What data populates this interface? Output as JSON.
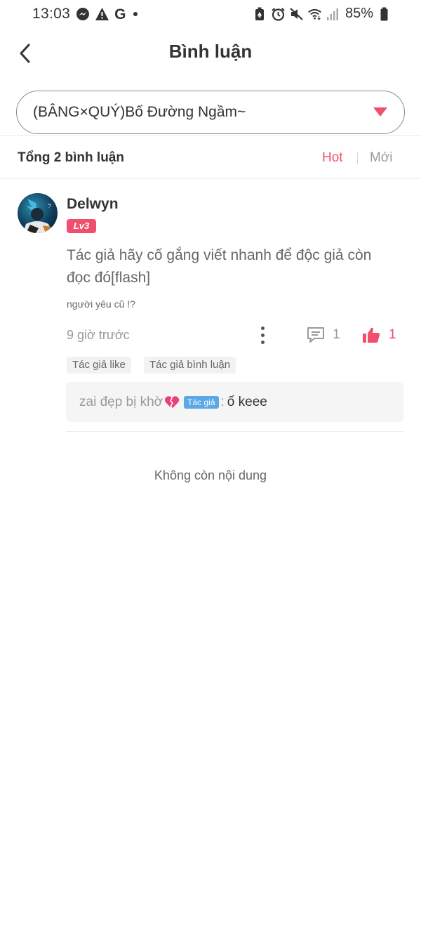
{
  "status_bar": {
    "time": "13:03",
    "battery": "85%",
    "left_icons": [
      "messenger-icon",
      "alert-icon",
      "google-icon"
    ],
    "right_icons": [
      "battery-saver-icon",
      "alarm-icon",
      "mute-icon",
      "wifi-icon",
      "signal-icon",
      "battery-icon"
    ]
  },
  "header": {
    "title": "Bình luận"
  },
  "chapter_select": {
    "value": "(BÂNG×QUÝ)Bố Đường Ngầm~"
  },
  "comments_summary": {
    "count_label": "Tổng 2 bình luận",
    "sort_hot": "Hot",
    "sort_new": "Mới"
  },
  "comment": {
    "username": "Delwyn",
    "level": "Lv3",
    "body": "Tác giả hãy cố gắng viết nhanh để độc giả còn đọc đó[flash]",
    "sub": "người yêu cũ !?",
    "time": "9 giờ trước",
    "reply_count": "1",
    "like_count": "1",
    "tags": [
      "Tác giả like",
      "Tác giả bình luận"
    ],
    "reply": {
      "author": "zai đẹp bị khờ",
      "author_badge": "Tác giả",
      "separator": ":",
      "text": "ố keee"
    }
  },
  "footer": {
    "no_more": "Không còn nội dung"
  },
  "colors": {
    "accent": "#f0506e",
    "author_badge": "#5aa9e6",
    "reply_bg": "#f5f5f5"
  }
}
